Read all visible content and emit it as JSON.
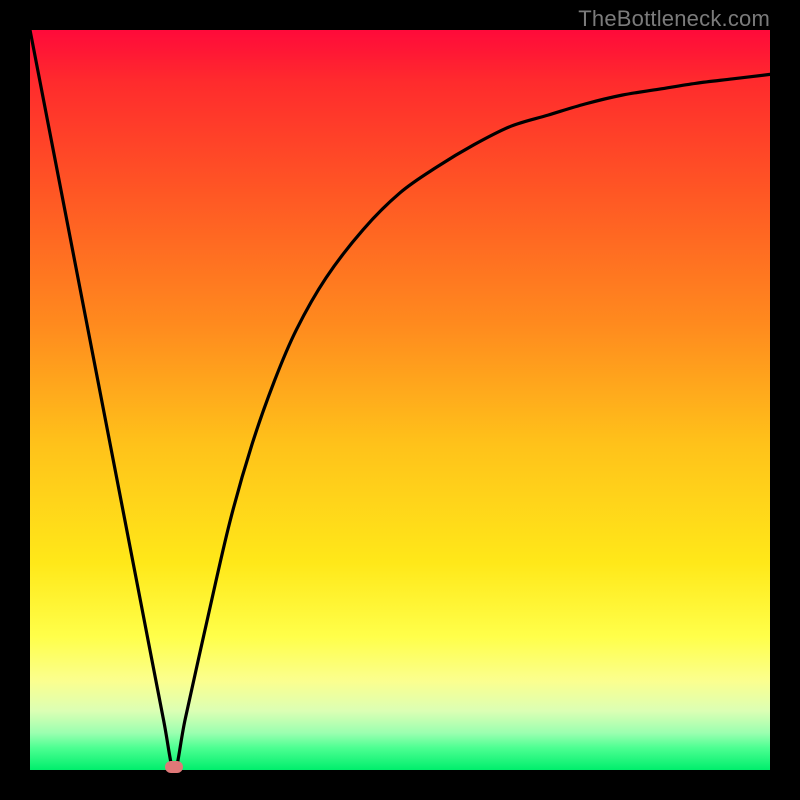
{
  "watermark_text": "TheBottleneck.com",
  "chart_data": {
    "type": "line",
    "title": "",
    "xlabel": "",
    "ylabel": "",
    "xlim": [
      0,
      1
    ],
    "ylim": [
      0,
      1
    ],
    "series": [
      {
        "name": "curve",
        "x": [
          0.0,
          0.03,
          0.06,
          0.09,
          0.12,
          0.15,
          0.18,
          0.195,
          0.21,
          0.24,
          0.27,
          0.3,
          0.33,
          0.36,
          0.4,
          0.45,
          0.5,
          0.55,
          0.6,
          0.65,
          0.7,
          0.75,
          0.8,
          0.85,
          0.9,
          0.95,
          1.0
        ],
        "y": [
          1.0,
          0.845,
          0.69,
          0.535,
          0.38,
          0.225,
          0.07,
          0.0,
          0.07,
          0.205,
          0.335,
          0.44,
          0.525,
          0.595,
          0.665,
          0.73,
          0.78,
          0.815,
          0.845,
          0.87,
          0.885,
          0.9,
          0.912,
          0.92,
          0.928,
          0.934,
          0.94
        ]
      }
    ],
    "marker": {
      "x": 0.195,
      "y": 0.004
    },
    "background_gradient": {
      "stops": [
        {
          "pos": 0.0,
          "color": "#ff0a3a"
        },
        {
          "pos": 0.07,
          "color": "#ff2b2d"
        },
        {
          "pos": 0.2,
          "color": "#ff5125"
        },
        {
          "pos": 0.4,
          "color": "#ff8b1e"
        },
        {
          "pos": 0.56,
          "color": "#ffc21a"
        },
        {
          "pos": 0.72,
          "color": "#ffe819"
        },
        {
          "pos": 0.82,
          "color": "#ffff4a"
        },
        {
          "pos": 0.88,
          "color": "#fbff8f"
        },
        {
          "pos": 0.92,
          "color": "#dcffb4"
        },
        {
          "pos": 0.95,
          "color": "#9bffb0"
        },
        {
          "pos": 0.97,
          "color": "#4dff92"
        },
        {
          "pos": 1.0,
          "color": "#00ee6c"
        }
      ]
    }
  }
}
